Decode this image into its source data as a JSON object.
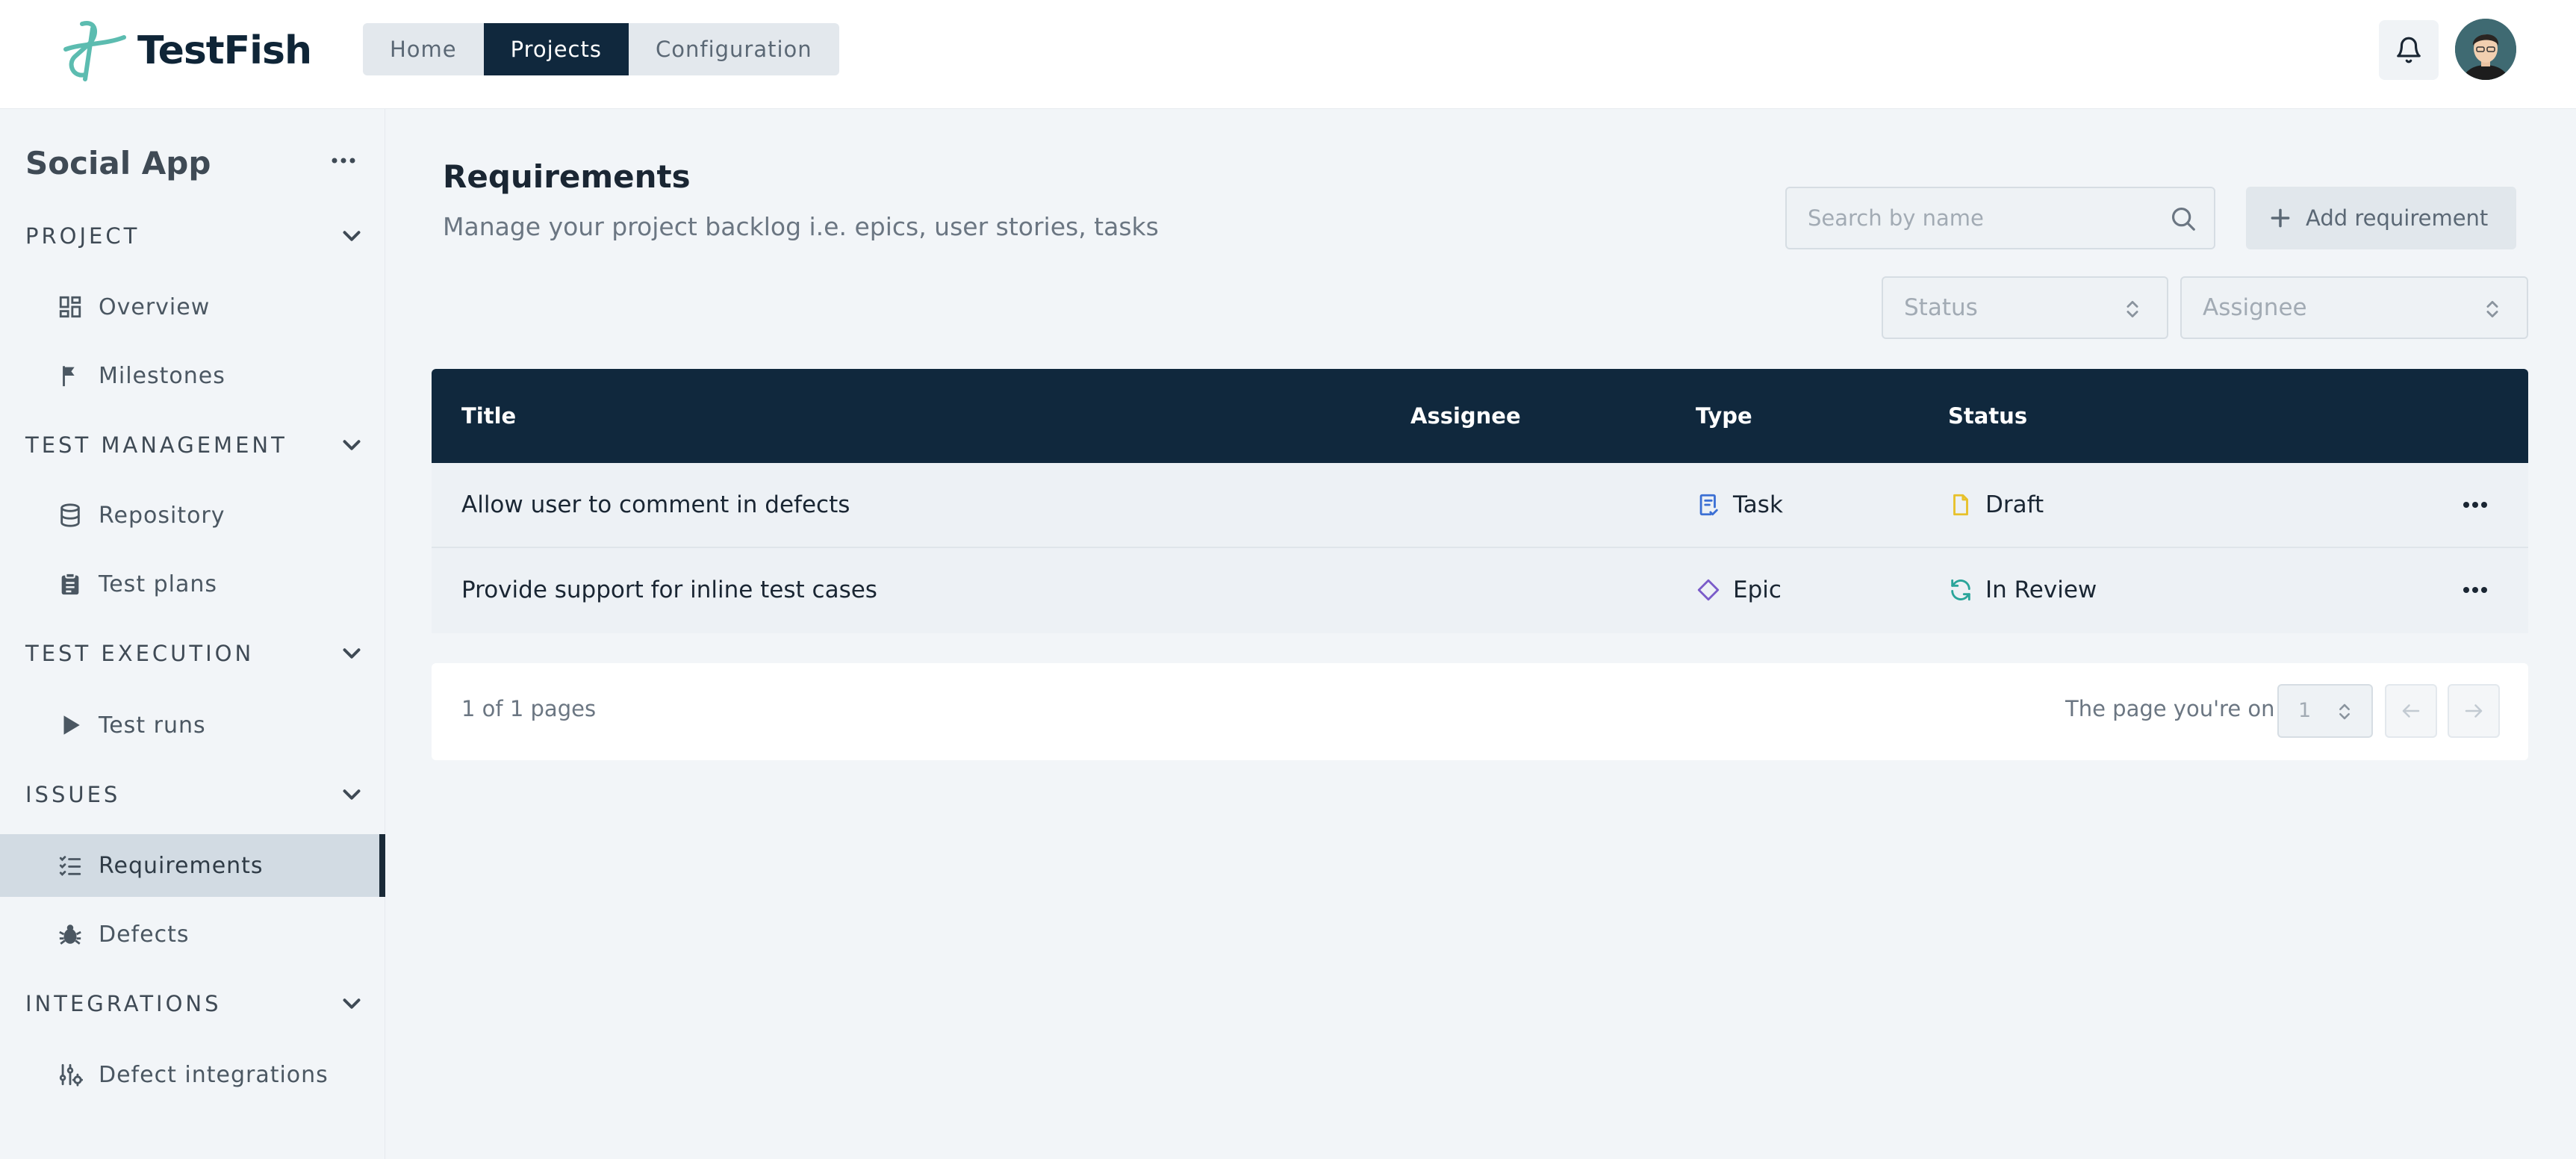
{
  "app": {
    "logo_text": "TestFish"
  },
  "topnav": [
    {
      "label": "Home",
      "active": false
    },
    {
      "label": "Projects",
      "active": true
    },
    {
      "label": "Configuration",
      "active": false
    }
  ],
  "sidebar": {
    "project_name": "Social App",
    "sections": [
      {
        "label": "PROJECT",
        "items": [
          {
            "label": "Overview",
            "icon": "grid-icon"
          },
          {
            "label": "Milestones",
            "icon": "flag-icon"
          }
        ]
      },
      {
        "label": "TEST MANAGEMENT",
        "items": [
          {
            "label": "Repository",
            "icon": "database-icon"
          },
          {
            "label": "Test plans",
            "icon": "clipboard-icon"
          }
        ]
      },
      {
        "label": "TEST EXECUTION",
        "items": [
          {
            "label": "Test runs",
            "icon": "play-icon"
          }
        ]
      },
      {
        "label": "ISSUES",
        "items": [
          {
            "label": "Requirements",
            "icon": "list-check-icon",
            "active": true
          },
          {
            "label": "Defects",
            "icon": "bug-icon"
          }
        ]
      },
      {
        "label": "INTEGRATIONS",
        "items": [
          {
            "label": "Defect integrations",
            "icon": "sliders-icon"
          }
        ]
      }
    ]
  },
  "main": {
    "title": "Requirements",
    "subtitle": "Manage your project backlog i.e. epics, user stories, tasks",
    "search_placeholder": "Search by name",
    "add_button": "Add requirement",
    "filters": {
      "status_placeholder": "Status",
      "assignee_placeholder": "Assignee"
    }
  },
  "table": {
    "columns": [
      "Title",
      "Assignee",
      "Type",
      "Status"
    ],
    "rows": [
      {
        "title": "Allow user to comment in defects",
        "assignee": "",
        "type": "Task",
        "type_icon": "task-icon",
        "status": "Draft",
        "status_icon": "file-icon"
      },
      {
        "title": "Provide support for inline test cases",
        "assignee": "",
        "type": "Epic",
        "type_icon": "diamond-icon",
        "status": "In Review",
        "status_icon": "refresh-icon"
      }
    ]
  },
  "pagination": {
    "info": "1 of 1 pages",
    "label": "The page you're on",
    "current_page": "1"
  },
  "colors": {
    "navy": "#10283d",
    "accent_teal": "#3dae9c",
    "task_blue": "#3b6fd4",
    "epic_purple": "#7a5bc9",
    "draft_yellow": "#e7c12a",
    "review_teal": "#2aa59a"
  }
}
